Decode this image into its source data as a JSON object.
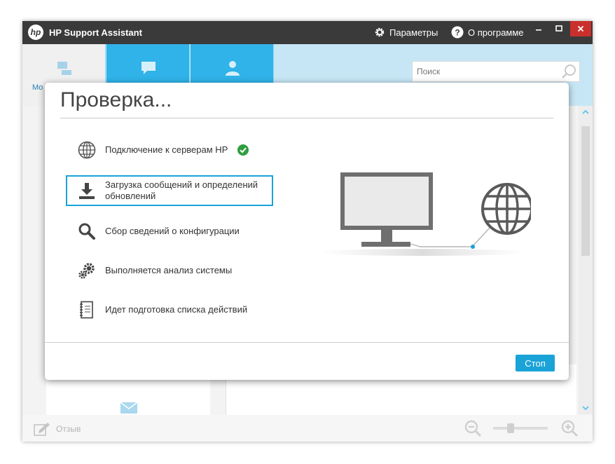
{
  "window": {
    "app_title": "HP Support Assistant",
    "settings_label": "Параметры",
    "about_label": "О программе",
    "logo_text": "hp"
  },
  "background": {
    "nav_first_label": "Мо",
    "search_placeholder": "Поиск",
    "feedback_label": "Отзыв"
  },
  "dialog": {
    "title": "Проверка...",
    "steps": [
      {
        "label": "Подключение к серверам HP",
        "icon": "globe-icon",
        "status": "done"
      },
      {
        "label": "Загрузка сообщений и определений обновлений",
        "icon": "download-icon",
        "status": "active"
      },
      {
        "label": "Сбор сведений о конфигурации",
        "icon": "magnifier-icon",
        "status": "pending"
      },
      {
        "label": "Выполняется анализ системы",
        "icon": "gears-icon",
        "status": "pending"
      },
      {
        "label": "Идет подготовка списка действий",
        "icon": "notebook-icon",
        "status": "pending"
      }
    ],
    "stop_label": "Стоп"
  },
  "colors": {
    "accent": "#1aa3d7",
    "nav_blue": "#2fb3e8",
    "titlebar": "#3a3a3a",
    "close": "#c9302c",
    "success": "#2f9e3f"
  }
}
